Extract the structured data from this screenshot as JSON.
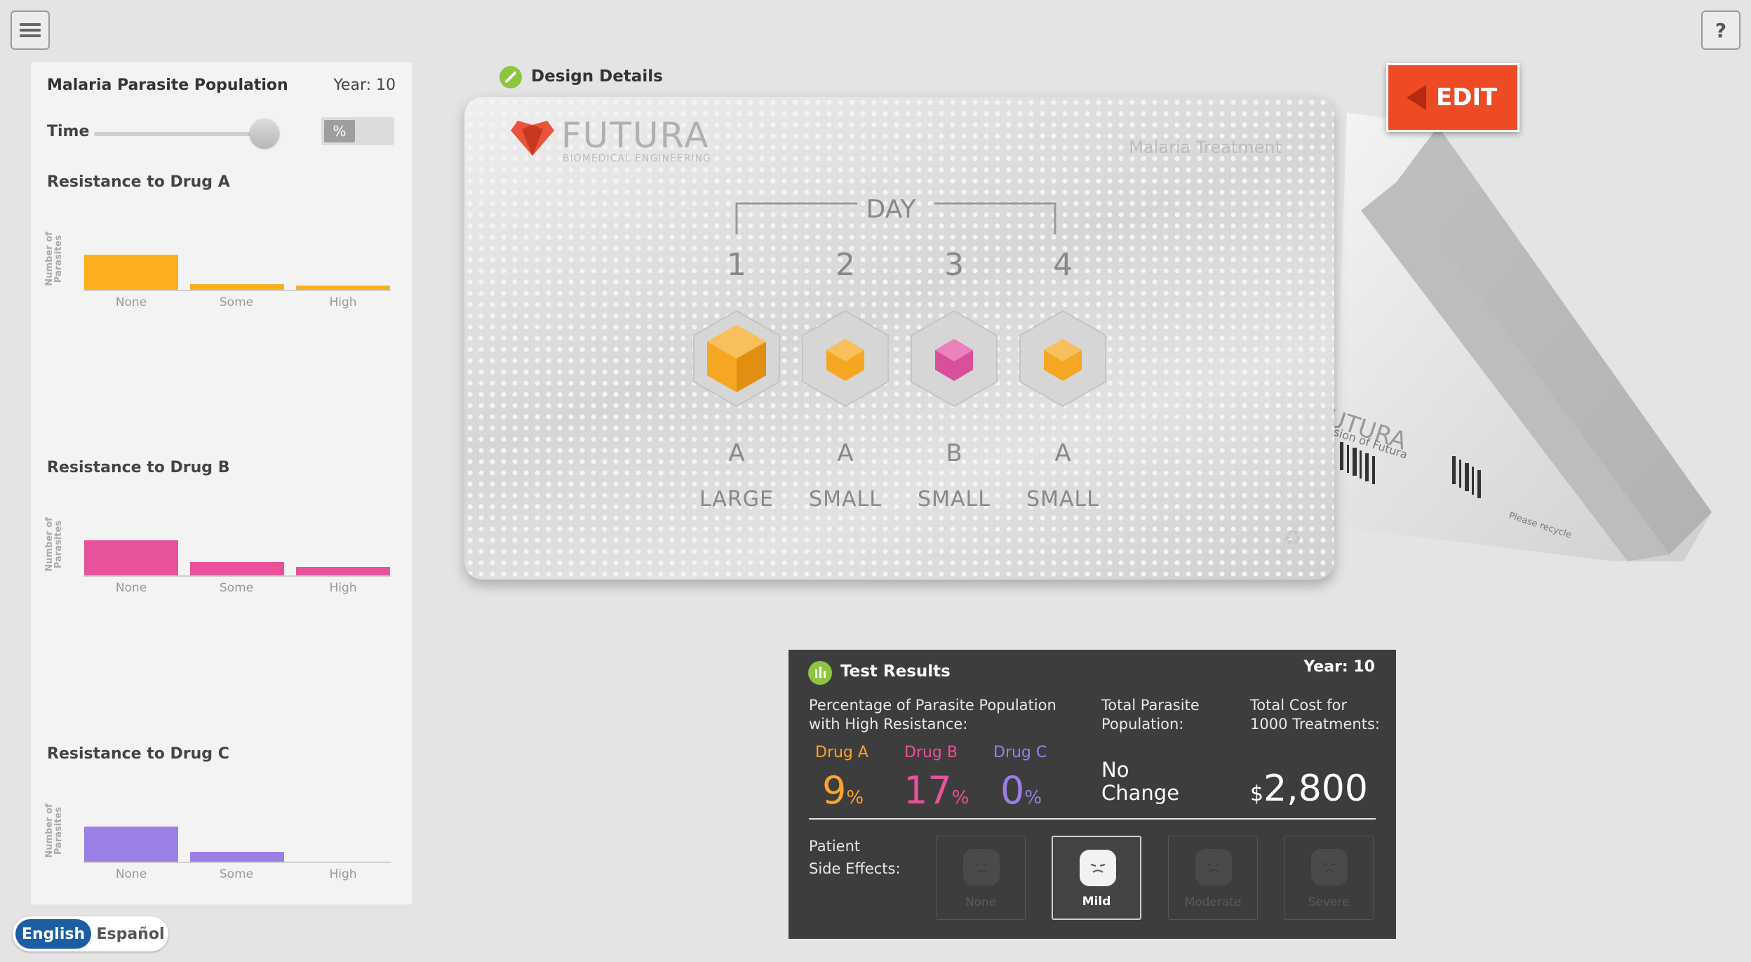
{
  "app": {
    "menu_icon": "hamburger-menu-icon",
    "help_label": "?"
  },
  "sidebar": {
    "title": "Malaria Parasite Population",
    "year": "Year: 10",
    "time_label": "Time",
    "time_slider_value": 1.0,
    "percent_toggle_label": "%",
    "y_axis_label_line1": "Number of",
    "y_axis_label_line2": "Parasites",
    "categories": [
      "None",
      "Some",
      "High"
    ],
    "charts": [
      {
        "heading": "Resistance to Drug A",
        "color": "#fcae1e"
      },
      {
        "heading": "Resistance to Drug B",
        "color": "#e8529b"
      },
      {
        "heading": "Resistance to Drug C",
        "color": "#9b7fe6"
      }
    ]
  },
  "chart_data": [
    {
      "type": "bar",
      "title": "Resistance to Drug A",
      "ylabel": "Number of Parasites",
      "categories": [
        "None",
        "Some",
        "High"
      ],
      "values": [
        100,
        16,
        12
      ]
    },
    {
      "type": "bar",
      "title": "Resistance to Drug B",
      "ylabel": "Number of Parasites",
      "categories": [
        "None",
        "Some",
        "High"
      ],
      "values": [
        100,
        38,
        24
      ]
    },
    {
      "type": "bar",
      "title": "Resistance to Drug C",
      "ylabel": "Number of Parasites",
      "categories": [
        "None",
        "Some",
        "High"
      ],
      "values": [
        100,
        28,
        0
      ]
    }
  ],
  "language": {
    "english": "English",
    "spanish": "Español",
    "selected": "English"
  },
  "design": {
    "title": "Design Details",
    "edit_label": "EDIT",
    "brand_name": "FUTURA",
    "brand_sub": "BIOMEDICAL ENGINEERING",
    "product": "Malaria Treatment",
    "day_label": "DAY",
    "days": [
      {
        "day": "1",
        "drug": "A",
        "dose": "LARGE",
        "color": "#f5a623"
      },
      {
        "day": "2",
        "drug": "A",
        "dose": "SMALL",
        "color": "#f5a623"
      },
      {
        "day": "3",
        "drug": "B",
        "dose": "SMALL",
        "color": "#d9509a"
      },
      {
        "day": "4",
        "drug": "A",
        "dose": "SMALL",
        "color": "#f5a623"
      }
    ],
    "box_text_brand": "UTURA",
    "box_text_sub": "sion of Futura",
    "box_text_recycle": "Please recycle",
    "recycle_icon": "recycle-icon"
  },
  "results": {
    "title": "Test Results",
    "year": "Year: 10",
    "pct_label_line1": "Percentage of Parasite Population",
    "pct_label_line2": "with High Resistance:",
    "total_pop_line1": "Total Parasite",
    "total_pop_line2": "Population:",
    "total_cost_line1": "Total Cost for",
    "total_cost_line2": "1000 Treatments:",
    "drugs": [
      {
        "name": "Drug A",
        "value": "9",
        "unit": "%",
        "color": "#f7a52c"
      },
      {
        "name": "Drug B",
        "value": "17",
        "unit": "%",
        "color": "#e8529b"
      },
      {
        "name": "Drug C",
        "value": "0",
        "unit": "%",
        "color": "#9b7fe6"
      }
    ],
    "population_change_line1": "No",
    "population_change_line2": "Change",
    "cost_currency": "$",
    "cost_value": "2,800",
    "side_effects_line1": "Patient",
    "side_effects_line2": "Side Effects:",
    "side_effect_options": [
      "None",
      "Mild",
      "Moderate",
      "Severe"
    ],
    "side_effect_selected": "Mild"
  }
}
